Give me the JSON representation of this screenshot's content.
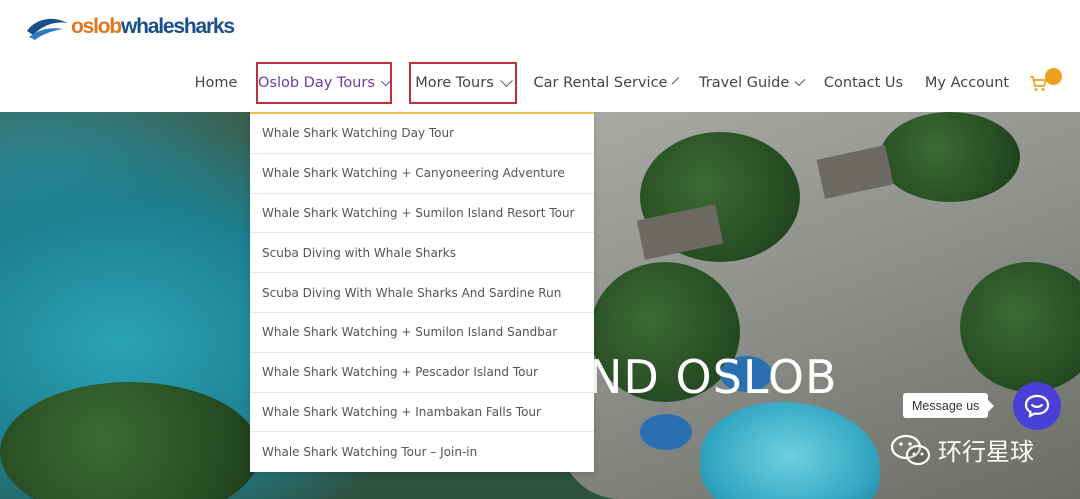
{
  "logo": {
    "part1": "oslob",
    "part2": "whalesharks"
  },
  "nav": {
    "items": [
      {
        "label": "Home"
      },
      {
        "label": "Oslob Day Tours"
      },
      {
        "label": "More Tours"
      },
      {
        "label": "Car Rental Service"
      },
      {
        "label": "Travel Guide"
      },
      {
        "label": "Contact Us"
      },
      {
        "label": "My Account"
      }
    ]
  },
  "dropdown": {
    "items": [
      "Whale Shark Watching Day Tour",
      "Whale Shark Watching + Canyoneering Adventure",
      "Whale Shark Watching + Sumilon Island Resort Tour",
      "Scuba Diving with Whale Sharks",
      "Scuba Diving With Whale Sharks And Sardine Run",
      "Whale Shark Watching + Sumilon Island Sandbar",
      "Whale Shark Watching + Pescador Island Tour",
      "Whale Shark Watching + Inambakan Falls Tour",
      "Whale Shark Watching Tour – Join-in"
    ]
  },
  "hero": {
    "title_visible": "ND OSLOB"
  },
  "messenger": {
    "label": "Message us"
  },
  "watermark": {
    "text": "环行星球"
  },
  "colors": {
    "accent": "#6b3fa0",
    "highlight_border": "#c0303a",
    "cart": "#f0a020",
    "messenger": "#4a3fd6"
  },
  "icons": {
    "cart": "shopping-cart-icon",
    "messenger": "chat-bubble-icon",
    "watermark": "wechat-icon"
  }
}
